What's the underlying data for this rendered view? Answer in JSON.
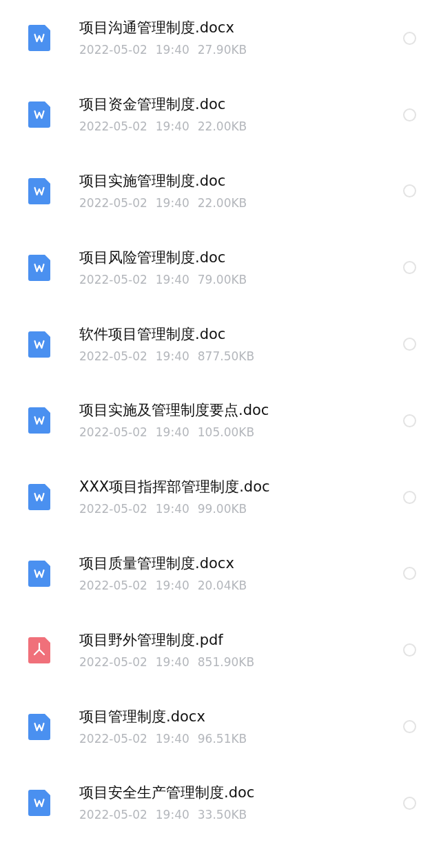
{
  "files": [
    {
      "kind": "word",
      "name": "项目沟通管理制度.docx",
      "date": "2022-05-02",
      "time": "19:40",
      "size": "27.90KB",
      "selected": false
    },
    {
      "kind": "word",
      "name": "项目资金管理制度.doc",
      "date": "2022-05-02",
      "time": "19:40",
      "size": "22.00KB",
      "selected": false
    },
    {
      "kind": "word",
      "name": "项目实施管理制度.doc",
      "date": "2022-05-02",
      "time": "19:40",
      "size": "22.00KB",
      "selected": false
    },
    {
      "kind": "word",
      "name": "项目风险管理制度.doc",
      "date": "2022-05-02",
      "time": "19:40",
      "size": "79.00KB",
      "selected": false
    },
    {
      "kind": "word",
      "name": "软件项目管理制度.doc",
      "date": "2022-05-02",
      "time": "19:40",
      "size": "877.50KB",
      "selected": false
    },
    {
      "kind": "word",
      "name": "项目实施及管理制度要点.doc",
      "date": "2022-05-02",
      "time": "19:40",
      "size": "105.00KB",
      "selected": false
    },
    {
      "kind": "word",
      "name": "XXX项目指挥部管理制度.doc",
      "date": "2022-05-02",
      "time": "19:40",
      "size": "99.00KB",
      "selected": false
    },
    {
      "kind": "word",
      "name": "项目质量管理制度.docx",
      "date": "2022-05-02",
      "time": "19:40",
      "size": "20.04KB",
      "selected": false
    },
    {
      "kind": "pdf",
      "name": "项目野外管理制度.pdf",
      "date": "2022-05-02",
      "time": "19:40",
      "size": "851.90KB",
      "selected": false
    },
    {
      "kind": "word",
      "name": "项目管理制度.docx",
      "date": "2022-05-02",
      "time": "19:40",
      "size": "96.51KB",
      "selected": false
    },
    {
      "kind": "word",
      "name": "项目安全生产管理制度.doc",
      "date": "2022-05-02",
      "time": "19:40",
      "size": "33.50KB",
      "selected": false
    }
  ]
}
